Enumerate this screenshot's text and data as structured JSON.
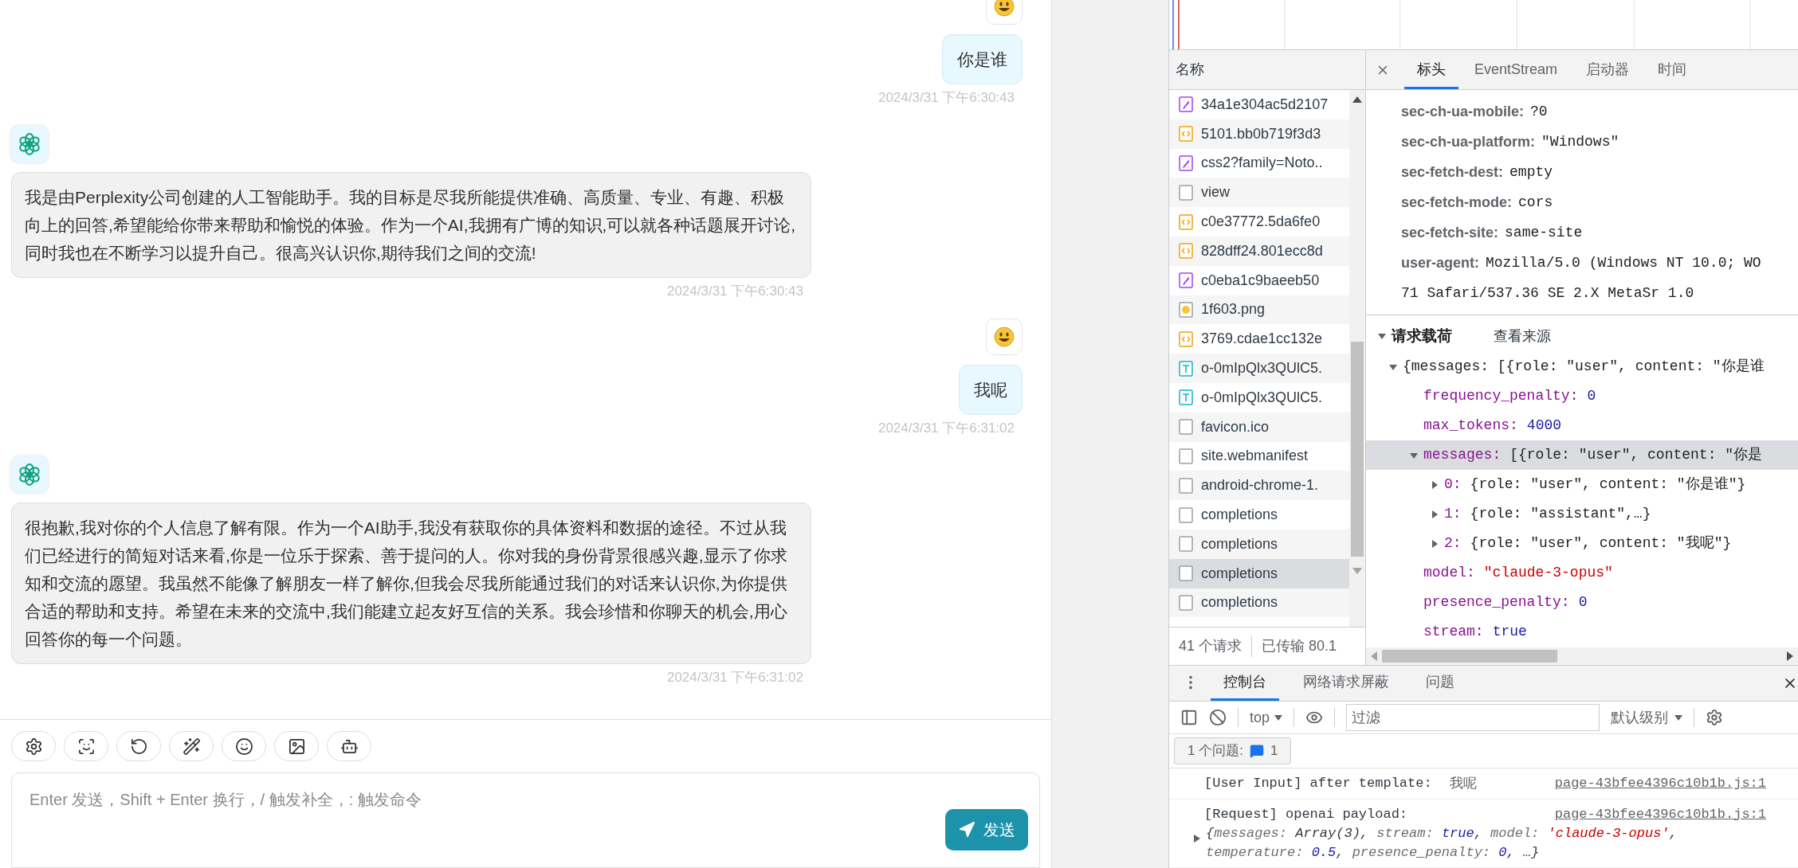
{
  "chat": {
    "messages": [
      {
        "kind": "user",
        "text": "你是谁",
        "time": "2024/3/31 下午6:30:43"
      },
      {
        "kind": "assistant",
        "text": "我是由Perplexity公司创建的人工智能助手。我的目标是尽我所能提供准确、高质量、专业、有趣、积极向上的回答,希望能给你带来帮助和愉悦的体验。作为一个AI,我拥有广博的知识,可以就各种话题展开讨论,同时我也在不断学习以提升自己。很高兴认识你,期待我们之间的交流!",
        "time": "2024/3/31 下午6:30:43"
      },
      {
        "kind": "user",
        "text": "我呢",
        "time": "2024/3/31 下午6:31:02"
      },
      {
        "kind": "assistant",
        "text": "很抱歉,我对你的个人信息了解有限。作为一个AI助手,我没有获取你的具体资料和数据的途径。不过从我们已经进行的简短对话来看,你是一位乐于探索、善于提问的人。你对我的身份背景很感兴趣,显示了你求知和交流的愿望。我虽然不能像了解朋友一样了解你,但我会尽我所能通过我们的对话来认识你,为你提供合适的帮助和支持。希望在未来的交流中,我们能建立起友好互信的关系。我会珍惜和你聊天的机会,用心回答你的每一个问题。",
        "time": "2024/3/31 下午6:31:02"
      }
    ]
  },
  "composer": {
    "placeholder": "Enter 发送，Shift + Enter 换行，/ 触发补全，: 触发命令",
    "send_label": "发送"
  },
  "network": {
    "column_header": "名称",
    "requests": [
      {
        "name": "34a1e304ac5d2107",
        "kind": "style",
        "selected": false
      },
      {
        "name": "5101.bb0b719f3d3",
        "kind": "script",
        "selected": false
      },
      {
        "name": "css2?family=Noto..",
        "kind": "style",
        "selected": false
      },
      {
        "name": "view",
        "kind": "document",
        "selected": false
      },
      {
        "name": "c0e37772.5da6fe0",
        "kind": "script",
        "selected": false
      },
      {
        "name": "828dff24.801ecc8d",
        "kind": "script",
        "selected": false
      },
      {
        "name": "c0eba1c9baeeb50",
        "kind": "style",
        "selected": false
      },
      {
        "name": "1f603.png",
        "kind": "image",
        "selected": false
      },
      {
        "name": "3769.cdae1cc132e",
        "kind": "script",
        "selected": false
      },
      {
        "name": "o-0mIpQlx3QUlC5.",
        "kind": "font",
        "selected": false
      },
      {
        "name": "o-0mIpQlx3QUlC5.",
        "kind": "font",
        "selected": false
      },
      {
        "name": "favicon.ico",
        "kind": "document",
        "selected": false
      },
      {
        "name": "site.webmanifest",
        "kind": "document",
        "selected": false
      },
      {
        "name": "android-chrome-1.",
        "kind": "document",
        "selected": false
      },
      {
        "name": "completions",
        "kind": "document",
        "selected": false
      },
      {
        "name": "completions",
        "kind": "document",
        "selected": false
      },
      {
        "name": "completions",
        "kind": "document",
        "selected": true
      },
      {
        "name": "completions",
        "kind": "document",
        "selected": false
      }
    ],
    "summary": [
      "41 个请求",
      "已传输 80.1"
    ]
  },
  "details": {
    "tabs": [
      {
        "label": "标头",
        "selected": true
      },
      {
        "label": "EventStream",
        "selected": false
      },
      {
        "label": "启动器",
        "selected": false
      },
      {
        "label": "时间",
        "selected": false
      }
    ],
    "headers": [
      {
        "name": "sec-ch-ua-mobile:",
        "value": "?0"
      },
      {
        "name": "sec-ch-ua-platform:",
        "value": "\"Windows\""
      },
      {
        "name": "sec-fetch-dest:",
        "value": "empty"
      },
      {
        "name": "sec-fetch-mode:",
        "value": "cors"
      },
      {
        "name": "sec-fetch-site:",
        "value": "same-site"
      },
      {
        "name": "user-agent:",
        "value": "Mozilla/5.0 (Windows NT 10.0; WO",
        "continuation": "71 Safari/537.36 SE 2.X MetaSr 1.0"
      }
    ],
    "payload": {
      "title": "请求载荷",
      "expanded": true,
      "source_link": "查看来源",
      "tree": [
        {
          "value": "{messages: [{role: \"user\", content: \"你是谁",
          "kind": "object",
          "expanded": true,
          "selected": false,
          "children": [
            {
              "key": "frequency_penalty:",
              "value": "0",
              "kind": "number",
              "selected": false
            },
            {
              "key": "max_tokens:",
              "value": "4000",
              "kind": "number",
              "selected": false
            },
            {
              "key": "messages:",
              "value": "[{role: \"user\", content: \"你是",
              "kind": "object",
              "expanded": true,
              "selected": true,
              "children": [
                {
                  "key": "0:",
                  "value": "{role: \"user\", content: \"你是谁\"}",
                  "kind": "object",
                  "expanded": false,
                  "selected": false
                },
                {
                  "key": "1:",
                  "value": "{role: \"assistant\",…}",
                  "kind": "object",
                  "expanded": false,
                  "selected": false
                },
                {
                  "key": "2:",
                  "value": "{role: \"user\", content: \"我呢\"}",
                  "kind": "object",
                  "expanded": false,
                  "selected": false
                }
              ]
            },
            {
              "key": "model:",
              "value": "\"claude-3-opus\"",
              "kind": "string",
              "selected": false
            },
            {
              "key": "presence_penalty:",
              "value": "0",
              "kind": "number",
              "selected": false
            },
            {
              "key": "stream:",
              "value": "true",
              "kind": "number",
              "selected": false
            }
          ]
        }
      ]
    }
  },
  "console": {
    "tabs": [
      {
        "label": "控制台",
        "selected": true
      },
      {
        "label": "网络请求屏蔽",
        "selected": false
      },
      {
        "label": "问题",
        "selected": false
      }
    ],
    "context": "top",
    "filter_placeholder": "过滤",
    "level": "默认级别",
    "issues_label": "1 个问题:",
    "issues_count": "1",
    "messages": [
      {
        "text": "[User Input] after template:",
        "value": "我呢",
        "source": "page-43bfee4396c10b1b.js:1"
      },
      {
        "text": "[Request] openai payload:",
        "source": "page-43bfee4396c10b1b.js:1",
        "preview": [
          [
            {
              "text": "{",
              "kind": "value"
            },
            {
              "text": "messages: ",
              "kind": "key"
            },
            {
              "text": "Array(3), ",
              "kind": "value"
            },
            {
              "text": "stream: ",
              "kind": "key"
            },
            {
              "text": "true",
              "kind": "keyword"
            },
            {
              "text": ", ",
              "kind": "value"
            },
            {
              "text": "model: ",
              "kind": "key"
            },
            {
              "text": "'claude-3-opus'",
              "kind": "string"
            },
            {
              "text": ",",
              "kind": "value"
            }
          ],
          [
            {
              "text": "temperature: ",
              "kind": "key"
            },
            {
              "text": "0.5",
              "kind": "number"
            },
            {
              "text": ", ",
              "kind": "value"
            },
            {
              "text": "presence_penalty: ",
              "kind": "key"
            },
            {
              "text": "0",
              "kind": "number"
            },
            {
              "text": ", …}",
              "kind": "value"
            }
          ]
        ]
      }
    ]
  }
}
